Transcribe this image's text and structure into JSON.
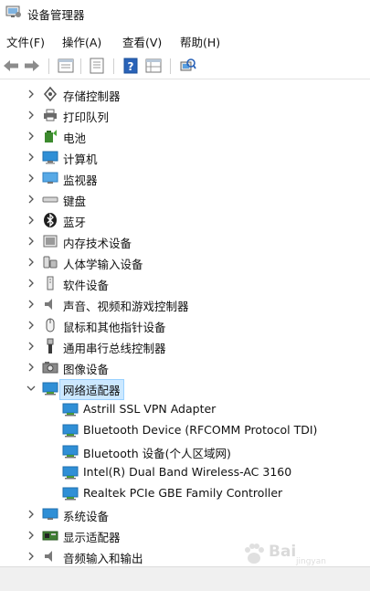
{
  "window": {
    "title": "设备管理器"
  },
  "menu": [
    {
      "label": "文件(F)"
    },
    {
      "label": "操作(A)"
    },
    {
      "label": "查看(V)"
    },
    {
      "label": "帮助(H)"
    }
  ],
  "toolbar": {
    "icons": [
      "back-arrow-icon",
      "forward-arrow-icon",
      "properties-grid-icon",
      "document-icon",
      "help-icon",
      "details-grid-icon",
      "scan-hardware-icon"
    ]
  },
  "tree": {
    "categories_top": [
      {
        "label": "存储控制器",
        "icon": "storage-controller-icon"
      },
      {
        "label": "打印队列",
        "icon": "printer-icon"
      },
      {
        "label": "电池",
        "icon": "battery-icon"
      },
      {
        "label": "计算机",
        "icon": "computer-icon"
      },
      {
        "label": "监视器",
        "icon": "monitor-icon"
      },
      {
        "label": "键盘",
        "icon": "keyboard-icon"
      },
      {
        "label": "蓝牙",
        "icon": "bluetooth-icon"
      },
      {
        "label": "内存技术设备",
        "icon": "memory-device-icon"
      },
      {
        "label": "人体学输入设备",
        "icon": "hid-icon"
      },
      {
        "label": "软件设备",
        "icon": "software-device-icon"
      },
      {
        "label": "声音、视频和游戏控制器",
        "icon": "speaker-icon"
      },
      {
        "label": "鼠标和其他指针设备",
        "icon": "mouse-icon"
      },
      {
        "label": "通用串行总线控制器",
        "icon": "usb-icon"
      },
      {
        "label": "图像设备",
        "icon": "camera-icon"
      }
    ],
    "expanded": {
      "label": "网络适配器",
      "icon": "network-adapter-icon",
      "children": [
        {
          "label": "Astrill SSL VPN Adapter"
        },
        {
          "label": "Bluetooth Device (RFCOMM Protocol TDI)"
        },
        {
          "label": "Bluetooth 设备(个人区域网)"
        },
        {
          "label": "Intel(R) Dual Band Wireless-AC 3160"
        },
        {
          "label": "Realtek PCIe GBE Family Controller"
        }
      ]
    },
    "categories_bottom": [
      {
        "label": "系统设备",
        "icon": "system-device-icon"
      },
      {
        "label": "显示适配器",
        "icon": "display-adapter-icon"
      },
      {
        "label": "音频输入和输出",
        "icon": "audio-io-icon"
      }
    ]
  },
  "watermark": {
    "text": "Bai",
    "sub": "jingyan"
  },
  "colors": {
    "selection": "#cce8ff",
    "selection_border": "#99d1ff",
    "monitor_blue": "#2f8fd6"
  }
}
